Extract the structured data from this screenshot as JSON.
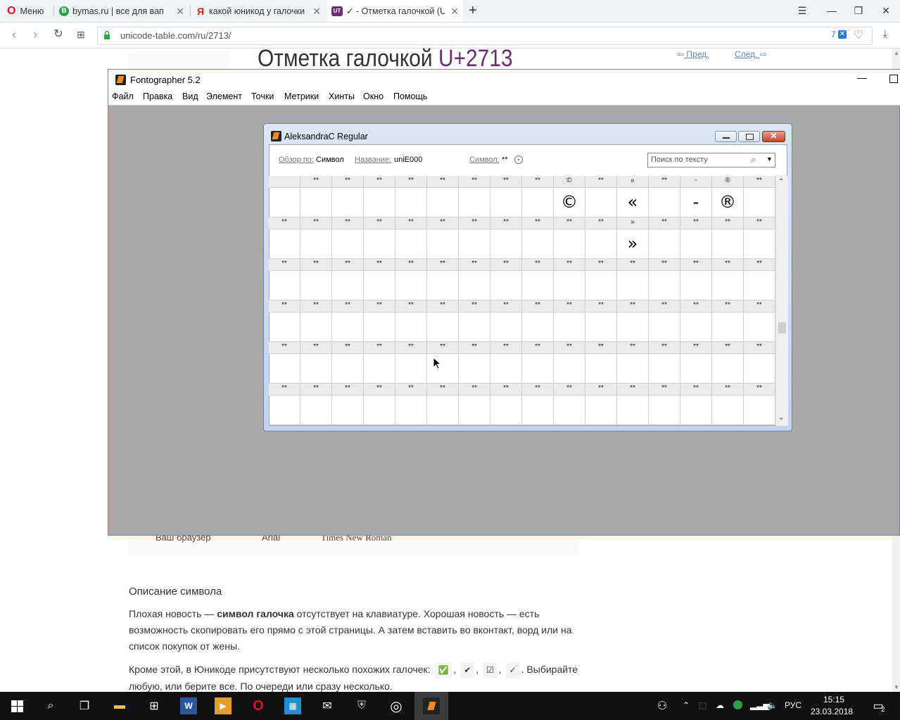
{
  "browser": {
    "menu_label": "Меню",
    "tabs": [
      {
        "title": "bymas.ru | все для вап",
        "favicon": "B",
        "favicon_color": "#2e9e4a"
      },
      {
        "title": "какой юникод у галочки",
        "favicon": "Я",
        "favicon_color": "#ffffff"
      },
      {
        "title": "✓ - Отметка галочкой (U",
        "favicon": "UT",
        "favicon_color": "#6b2d6e",
        "active": true
      }
    ],
    "url": "unicode-table.com/ru/2713/",
    "badge_count": "7"
  },
  "page": {
    "title_prefix": "Отметка галочкой",
    "title_code": "U+2713",
    "prev_label": "Пред.",
    "next_label": "След.",
    "browser_row": [
      "Ваш браузер",
      "Arial",
      "Times New Roman"
    ],
    "desc_heading": "Описание символа",
    "para1_pre": "Плохая новость — ",
    "para1_bold": "символ галочка",
    "para1_post": " отсутствует на клавиатуре. Хорошая новость — есть возможность скопировать его прямо с этой страницы. А затем вставить во вконтакт, ворд или на список покупок от жены.",
    "para2_pre": "Кроме этой, в Юникоде присутствуют несколько похожих галочек: ",
    "similar": [
      "✅",
      "✔",
      "☑",
      "✓"
    ],
    "para2_post": ". Выбирайте любую, или берите все. По очереди или сразу несколько."
  },
  "fontographer": {
    "title": "Fontographer 5.2",
    "menu": [
      "Файл",
      "Правка",
      "Вид",
      "Элемент",
      "Точки",
      "Метрики",
      "Хинты",
      "Окно",
      "Помощь"
    ],
    "font_window": {
      "title": "AleksandraC Regular",
      "view_by_label": "Обзор по:",
      "view_by_value": "Символ",
      "name_label": "Название:",
      "name_value": "uniE000",
      "symbol_label": "Символ:",
      "symbol_value": "**",
      "search_placeholder": "Поиск по тексту"
    },
    "grid_rows": [
      {
        "headers": [
          "",
          "**",
          "**",
          "**",
          "**",
          "**",
          "**",
          "**",
          "**",
          "©",
          "**",
          "«",
          "**",
          "-",
          "®",
          "**"
        ],
        "glyphs": [
          "",
          "",
          "",
          "",
          "",
          "",
          "",
          "",
          "",
          "©",
          "",
          "«",
          "",
          "-",
          "®",
          ""
        ]
      },
      {
        "headers": [
          "**",
          "**",
          "**",
          "**",
          "**",
          "**",
          "**",
          "**",
          "**",
          "**",
          "**",
          "»",
          "**",
          "**",
          "**",
          "**"
        ],
        "glyphs": [
          "",
          "",
          "",
          "",
          "",
          "",
          "",
          "",
          "",
          "",
          "",
          "»",
          "",
          "",
          "",
          ""
        ]
      },
      {
        "headers": [
          "**",
          "**",
          "**",
          "**",
          "**",
          "**",
          "**",
          "**",
          "**",
          "**",
          "**",
          "**",
          "**",
          "**",
          "**",
          "**"
        ],
        "glyphs": [
          "",
          "",
          "",
          "",
          "",
          "",
          "",
          "",
          "",
          "",
          "",
          "",
          "",
          "",
          "",
          ""
        ]
      },
      {
        "headers": [
          "**",
          "**",
          "**",
          "**",
          "**",
          "**",
          "**",
          "**",
          "**",
          "**",
          "**",
          "**",
          "**",
          "**",
          "**",
          "**"
        ],
        "glyphs": [
          "",
          "",
          "",
          "",
          "",
          "",
          "",
          "",
          "",
          "",
          "",
          "",
          "",
          "",
          "",
          ""
        ]
      },
      {
        "headers": [
          "**",
          "**",
          "**",
          "**",
          "**",
          "**",
          "**",
          "**",
          "**",
          "**",
          "**",
          "**",
          "**",
          "**",
          "**",
          "**"
        ],
        "glyphs": [
          "",
          "",
          "",
          "",
          "",
          "",
          "",
          "",
          "",
          "",
          "",
          "",
          "",
          "",
          "",
          ""
        ]
      },
      {
        "headers": [
          "**",
          "**",
          "**",
          "**",
          "**",
          "**",
          "**",
          "**",
          "**",
          "**",
          "**",
          "**",
          "**",
          "**",
          "**",
          "**"
        ],
        "glyphs": [
          "",
          "",
          "",
          "",
          "",
          "",
          "",
          "",
          "",
          "",
          "",
          "",
          "",
          "",
          "",
          ""
        ]
      }
    ]
  },
  "taskbar": {
    "lang": "РУС",
    "time": "15:15",
    "date": "23.03.2018",
    "notification_count": "2"
  }
}
